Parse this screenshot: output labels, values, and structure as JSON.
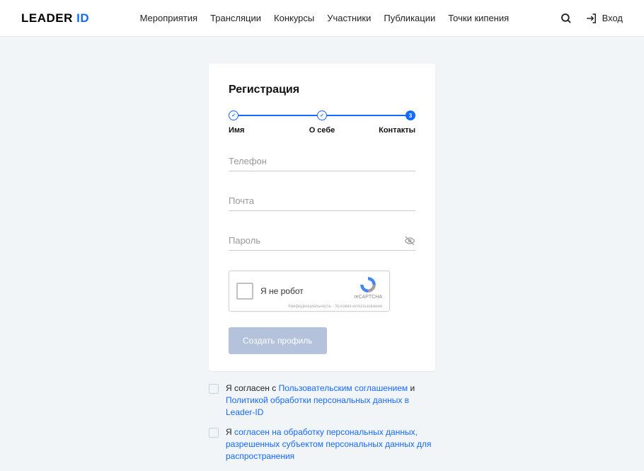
{
  "logo": {
    "leader": "LEADER",
    "id": "ID"
  },
  "nav": {
    "items": [
      {
        "label": "Мероприятия"
      },
      {
        "label": "Трансляции"
      },
      {
        "label": "Конкурсы"
      },
      {
        "label": "Участники"
      },
      {
        "label": "Публикации"
      },
      {
        "label": "Точки кипения"
      }
    ]
  },
  "login": {
    "label": "Вход"
  },
  "card": {
    "title": "Регистрация",
    "steps": {
      "active_number": "3",
      "labels": [
        "Имя",
        "О себе",
        "Контакты"
      ]
    },
    "fields": {
      "phone": {
        "placeholder": "Телефон"
      },
      "email": {
        "placeholder": "Почта"
      },
      "password": {
        "placeholder": "Пароль"
      }
    },
    "recaptcha": {
      "label": "Я не робот",
      "brand": "reCAPTCHA",
      "terms": "Конфиденциальность - Условия использования"
    },
    "submit": {
      "label": "Создать профиль"
    }
  },
  "agreements": [
    {
      "prefix": "Я согласен с ",
      "link1": "Пользовательским соглашением",
      "mid": " и ",
      "link2": "Политикой обработки персональных данных в Leader-ID"
    },
    {
      "prefix": "Я ",
      "link1": "согласен на обработку персональных данных, разрешенных субъектом персональных данных для распространения"
    }
  ]
}
